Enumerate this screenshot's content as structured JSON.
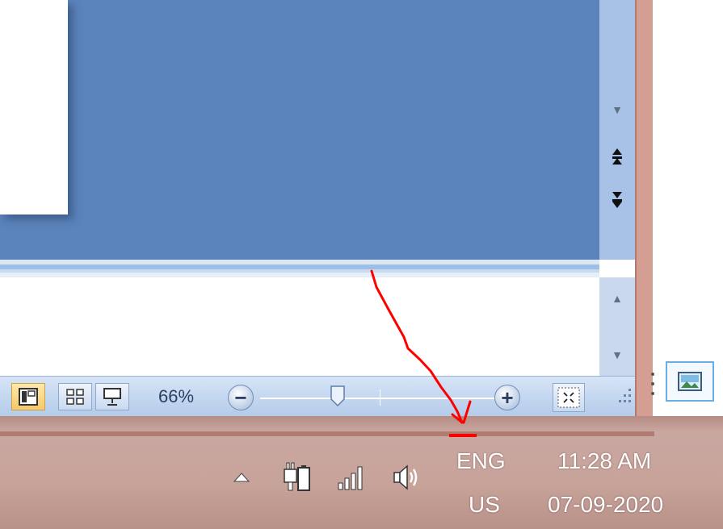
{
  "status_bar": {
    "zoom_level": "66%",
    "zoom_slider_percent": 66,
    "view_buttons": [
      {
        "name": "normal-view",
        "active": true
      },
      {
        "name": "slide-sorter-view",
        "active": false
      },
      {
        "name": "slide-show-view",
        "active": false
      }
    ]
  },
  "tray": {
    "language_top": "ENG",
    "language_bottom": "US",
    "time": "11:28 AM",
    "date": "07-09-2020",
    "icons": [
      "show-hidden-icons-arrow",
      "power-icon",
      "network-signal-icon",
      "volume-icon"
    ]
  },
  "colors": {
    "slide_background": "#5b84bc",
    "annotation_arrow": "#ff0000",
    "taskbar": "#c7a39a"
  }
}
